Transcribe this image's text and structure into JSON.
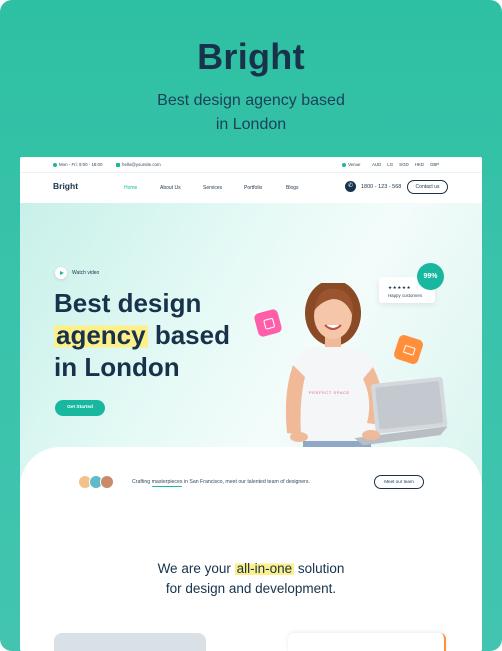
{
  "card": {
    "title": "Bright",
    "subtitle_line1": "Best design agency based",
    "subtitle_line2": "in London"
  },
  "topbar": {
    "hours": "Mon - Fri: 9:00 - 18:00",
    "email": "hello@yoursite.com",
    "location": "Venue",
    "currencies": [
      "AUD",
      "LG",
      "SGD",
      "HKD",
      "GBP"
    ]
  },
  "navbar": {
    "logo": "Bright",
    "items": [
      "Home",
      "About Us",
      "Services",
      "Portfolio",
      "Blogs"
    ],
    "active_index": 0,
    "phone": "1800 - 123 - 568",
    "contact_label": "Contact us"
  },
  "hero": {
    "watch_label": "Watch video",
    "headline_line1": "Best design",
    "headline_highlight": "agency",
    "headline_line2_rest": " based",
    "headline_line3": "in London",
    "cta_label": "Get Started",
    "rating_stars": "★★★★★",
    "rating_label": "Happy customers",
    "rating_percent": "99%",
    "shirt_text": "PERFECT SPACE",
    "icons": [
      "image-icon",
      "megaphone-icon",
      "play-icon",
      "phone-icon"
    ]
  },
  "team": {
    "text_before": "Crafting ",
    "text_underlined": "masterpieces",
    "text_after": " in San Francisco, meet our talented team of designers.",
    "button_label": "Meet our team"
  },
  "solution": {
    "line1_before": "We are your ",
    "line1_highlight": "all-in-one",
    "line1_after": " solution",
    "line2": "for design and development."
  },
  "colors": {
    "brand": "#18b8a0",
    "navy": "#17324a",
    "highlight": "#fdf08a",
    "pink": "#ff5fa8",
    "orange": "#ff8f3a"
  }
}
